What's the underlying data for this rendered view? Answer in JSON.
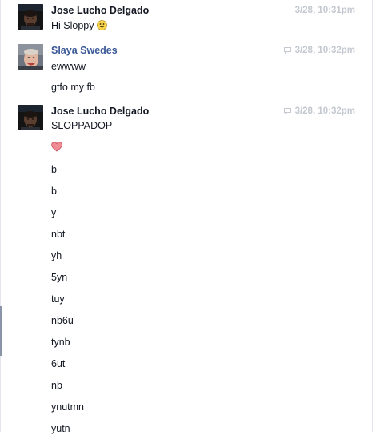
{
  "messages": [
    {
      "sender": "Jose Lucho Delgado",
      "timestamp": "3/28, 10:31pm",
      "show_chat_icon": false,
      "lines": [
        "Hi Sloppy"
      ]
    },
    {
      "sender": "Slaya Swedes",
      "timestamp": "3/28, 10:32pm",
      "show_chat_icon": true,
      "lines": [
        "ewwww",
        "gtfo my fb"
      ]
    },
    {
      "sender": "Jose Lucho Delgado",
      "timestamp": "3/28, 10:32pm",
      "show_chat_icon": true,
      "lines": [
        "SLOPPADOP",
        "",
        "b",
        "b",
        "y",
        "nbt",
        "yh",
        "5yn",
        "tuy",
        "nb6u",
        "tynb",
        "6ut",
        "nb",
        "ynutmn",
        "yutn"
      ]
    }
  ],
  "icons": {
    "smile": "smiley-emoji-icon",
    "heart": "heart-emoji-icon",
    "chat": "chat-bubble-icon"
  },
  "colors": {
    "sender_default": "#141823",
    "sender_link": "#3b5998",
    "timestamp": "#c4c8d0",
    "heart": "#e0707a"
  }
}
